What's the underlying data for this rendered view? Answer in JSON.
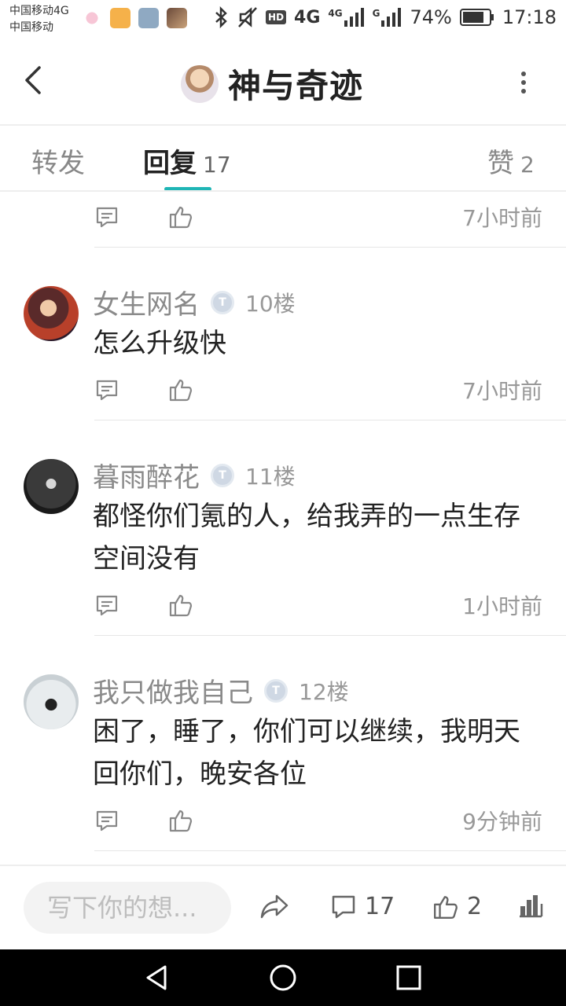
{
  "status_bar": {
    "carrier_line1": "中国移动4G",
    "carrier_line2": "中国移动",
    "network_a": "4G",
    "network_b": "4G",
    "network_c": "G",
    "battery": "74%",
    "time": "17:18",
    "hd_label": "HD"
  },
  "header": {
    "title": "神与奇迹"
  },
  "tabs": [
    {
      "label": "转发",
      "count": ""
    },
    {
      "label": "回复",
      "count": "17"
    },
    {
      "label": "赞",
      "count": "2"
    }
  ],
  "comments": [
    {
      "name": "",
      "floor": "",
      "text": "",
      "time": "7小时前"
    },
    {
      "name": "女生网名",
      "floor": "10楼",
      "text": "怎么升级快",
      "time": "7小时前"
    },
    {
      "name": "暮雨醉花",
      "floor": "11楼",
      "text": "都怪你们氪的人，给我弄的一点生存空间没有",
      "time": "1小时前"
    },
    {
      "name": "我只做我自己",
      "floor": "12楼",
      "text": "困了，睡了，你们可以继续，我明天回你们，晚安各位",
      "time": "9分钟前"
    }
  ],
  "badge_letter": "T",
  "bottom_bar": {
    "input_placeholder": "写下你的想...",
    "comment_count": "17",
    "like_count": "2"
  },
  "colors": {
    "accent": "#1fb5b5",
    "muted_text": "#8a8a8a"
  },
  "icons": [
    "back-icon",
    "more-icon",
    "comment-icon",
    "like-icon",
    "share-icon",
    "stats-icon",
    "nav-back-icon",
    "nav-home-icon",
    "nav-recent-icon"
  ]
}
